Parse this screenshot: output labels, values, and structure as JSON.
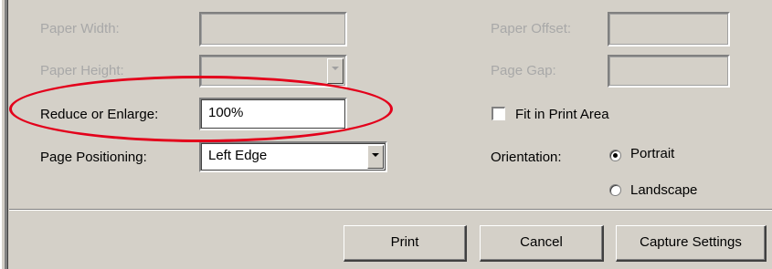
{
  "form": {
    "paper_width_label": "Paper Width:",
    "paper_height_label": "Paper Height:",
    "reduce_enlarge_label": "Reduce or Enlarge:",
    "reduce_enlarge_value": "100%",
    "page_positioning_label": "Page Positioning:",
    "page_positioning_value": "Left Edge",
    "paper_offset_label": "Paper Offset:",
    "page_gap_label": "Page Gap:",
    "fit_label": "Fit in Print Area",
    "orientation_label": "Orientation:",
    "portrait_label": "Portrait",
    "landscape_label": "Landscape",
    "orientation_selected": "Portrait",
    "fit_checked": false
  },
  "buttons": {
    "print": "Print",
    "cancel": "Cancel",
    "capture": "Capture Settings"
  },
  "icons": [
    "dropdown-arrow-icon"
  ],
  "colors": {
    "dialog_bg": "#d4d0c8",
    "disabled_text": "#a8a8a8",
    "annotation": "#e3001b"
  }
}
